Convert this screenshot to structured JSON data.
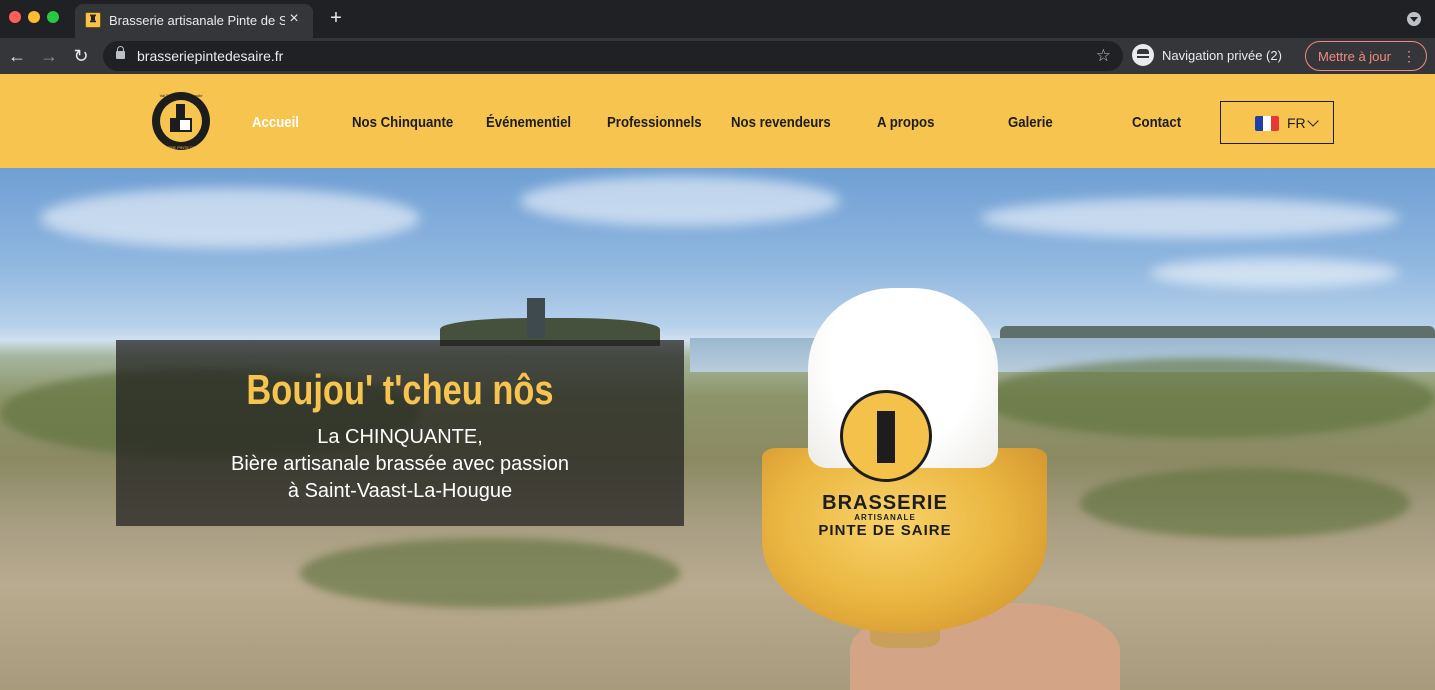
{
  "browser": {
    "tab_title": "Brasserie artisanale Pinte de Saire",
    "tab_close": "×",
    "new_tab": "+",
    "url": "brasseriepintedesaire.fr",
    "incognito_label": "Navigation privée (2)",
    "update_label": "Mettre à jour",
    "icons": [
      "back-arrow-icon",
      "forward-arrow-icon",
      "reload-icon",
      "lock-icon",
      "star-icon",
      "incognito-icon",
      "more-vert-icon"
    ]
  },
  "header": {
    "logo_text_top": "Val De Saire Normandie",
    "logo_text_bottom": "BRASSERIE PINTE DE SAIRE",
    "nav": [
      {
        "label": "Accueil",
        "active": true
      },
      {
        "label": "Nos Chinquante",
        "active": false
      },
      {
        "label": "Événementiel",
        "active": false
      },
      {
        "label": "Professionnels",
        "active": false
      },
      {
        "label": "Nos revendeurs",
        "active": false
      },
      {
        "label": "A propos",
        "active": false
      },
      {
        "label": "Galerie",
        "active": false
      },
      {
        "label": "Contact",
        "active": false
      }
    ],
    "language": "FR",
    "accent_color": "#f6c44f"
  },
  "hero": {
    "title": "Boujou' t'cheu nôs",
    "line1": "La CHINQUANTE,",
    "line2": "Bière artisanale brassée avec passion",
    "line3": "à Saint-Vaast-La-Hougue",
    "glass_brand_line1": "BRASSERIE",
    "glass_brand_line2": "ARTISANALE",
    "glass_brand_line3": "PINTE DE SAIRE"
  }
}
